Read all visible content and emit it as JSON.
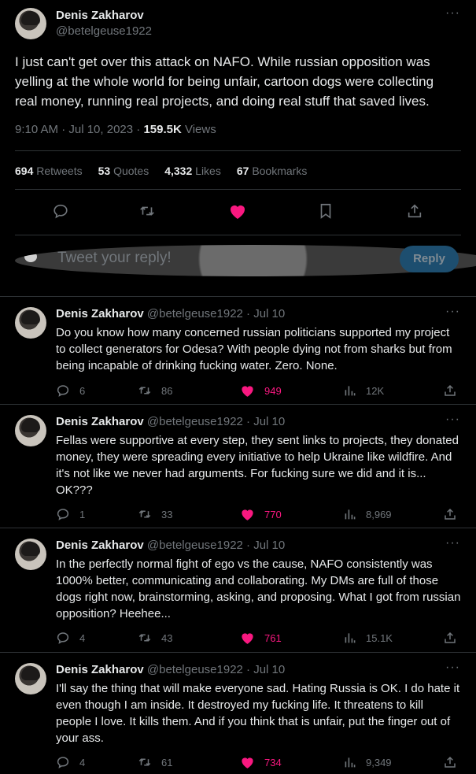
{
  "main_tweet": {
    "author_name": "Denis Zakharov",
    "author_handle": "@betelgeuse1922",
    "text": "I just can't get over this attack on NAFO. While russian opposition was yelling at the whole world for being unfair, cartoon dogs were collecting real money, running real projects, and doing real stuff that saved lives.",
    "time": "9:10 AM · Jul 10, 2023 · ",
    "views_count": "159.5K",
    "views_label": " Views",
    "stats": {
      "retweets_count": "694",
      "retweets_label": "Retweets",
      "quotes_count": "53",
      "quotes_label": "Quotes",
      "likes_count": "4,332",
      "likes_label": "Likes",
      "bookmarks_count": "67",
      "bookmarks_label": "Bookmarks"
    },
    "liked": true
  },
  "reply_composer": {
    "placeholder": "Tweet your reply!",
    "button_label": "Reply"
  },
  "replies": [
    {
      "name": "Denis Zakharov",
      "handle_date": "@betelgeuse1922 · Jul 10",
      "text": "Do you know how many concerned russian politicians supported my project to collect generators for Odesa? With people dying not from sharks but from being incapable of drinking fucking water. Zero. None.",
      "replies": "6",
      "retweets": "86",
      "likes": "949",
      "views": "12K"
    },
    {
      "name": "Denis Zakharov",
      "handle_date": "@betelgeuse1922 · Jul 10",
      "text": "Fellas were supportive at every step, they sent links to projects, they donated money, they were spreading every initiative to help Ukraine like wildfire. And it's not like we never had arguments. For fucking sure we did and it is... OK???",
      "replies": "1",
      "retweets": "33",
      "likes": "770",
      "views": "8,969"
    },
    {
      "name": "Denis Zakharov",
      "handle_date": "@betelgeuse1922 · Jul 10",
      "text": "In the perfectly normal fight of ego vs the cause, NAFO consistently was 1000% better, communicating and collaborating. My DMs are full of those dogs right now, brainstorming, asking, and proposing. What I got from russian opposition? Heehee...",
      "replies": "4",
      "retweets": "43",
      "likes": "761",
      "views": "15.1K"
    },
    {
      "name": "Denis Zakharov",
      "handle_date": "@betelgeuse1922 · Jul 10",
      "text": "I'll say the thing that will make everyone sad. Hating Russia is OK. I do hate it even though I am inside. It destroyed my fucking life. It threatens to kill people I love. It kills them. And if you think that is unfair, put the finger out of your ass.",
      "replies": "4",
      "retweets": "61",
      "likes": "734",
      "views": "9,349"
    }
  ],
  "icons": {
    "more": "more-dots-icon",
    "reply": "reply-bubble-icon",
    "retweet": "retweet-icon",
    "like": "heart-icon",
    "bookmark": "bookmark-icon",
    "share": "share-icon",
    "views": "views-chart-icon"
  },
  "colors": {
    "background": "#000000",
    "text": "#e7e9ea",
    "muted": "#71767b",
    "like": "#f91880",
    "reply_button": "#1d4e6f"
  }
}
